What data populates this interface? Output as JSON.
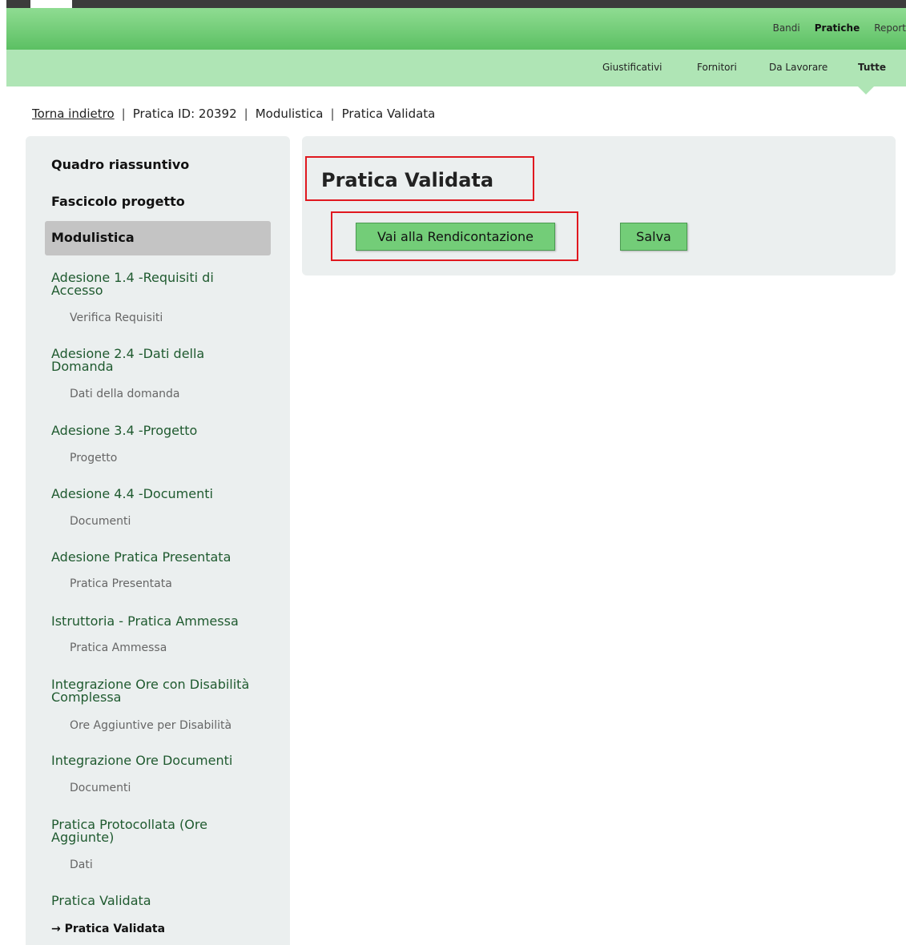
{
  "nav_top": {
    "items": [
      "Bandi",
      "Pratiche",
      "Report"
    ],
    "active": "Pratiche"
  },
  "nav_sub": {
    "items": [
      "Giustificativi",
      "Fornitori",
      "Da Lavorare",
      "Tutte"
    ],
    "active": "Tutte"
  },
  "breadcrumb": {
    "back_link": "Torna indietro",
    "separator": "|",
    "pratica": "Pratica ID: 20392",
    "section": "Modulistica",
    "current": "Pratica Validata"
  },
  "sidebar": {
    "quadro": "Quadro riassuntivo",
    "fascicolo": "Fascicolo progetto",
    "modulistica": "Modulistica",
    "sections": [
      {
        "title": "Adesione 1.4 -Requisiti di Accesso",
        "sub": "Verifica Requisiti"
      },
      {
        "title": "Adesione 2.4 -Dati della Domanda",
        "sub": "Dati della domanda"
      },
      {
        "title": "Adesione 3.4 -Progetto",
        "sub": "Progetto"
      },
      {
        "title": "Adesione 4.4 -Documenti",
        "sub": "Documenti"
      },
      {
        "title": "Adesione Pratica Presentata",
        "sub": "Pratica Presentata"
      },
      {
        "title": "Istruttoria - Pratica Ammessa",
        "sub": "Pratica Ammessa"
      },
      {
        "title": "Integrazione Ore con Disabilità Complessa",
        "sub": "Ore Aggiuntive per Disabilità"
      },
      {
        "title": "Integrazione Ore Documenti",
        "sub": "Documenti"
      },
      {
        "title": "Pratica Protocollata (Ore Aggiunte)",
        "sub": "Dati"
      },
      {
        "title": "Pratica Validata",
        "sub": "Pratica Validata",
        "current": true
      }
    ],
    "current_arrow": "→"
  },
  "main": {
    "title": "Pratica Validata",
    "btn_rendicontazione": "Vai alla Rendicontazione",
    "btn_salva": "Salva"
  },
  "colors": {
    "header_green": "#5cc063",
    "subnav_green": "#afe5b5",
    "button_green": "#73cd78",
    "highlight_red": "#e0181f"
  }
}
